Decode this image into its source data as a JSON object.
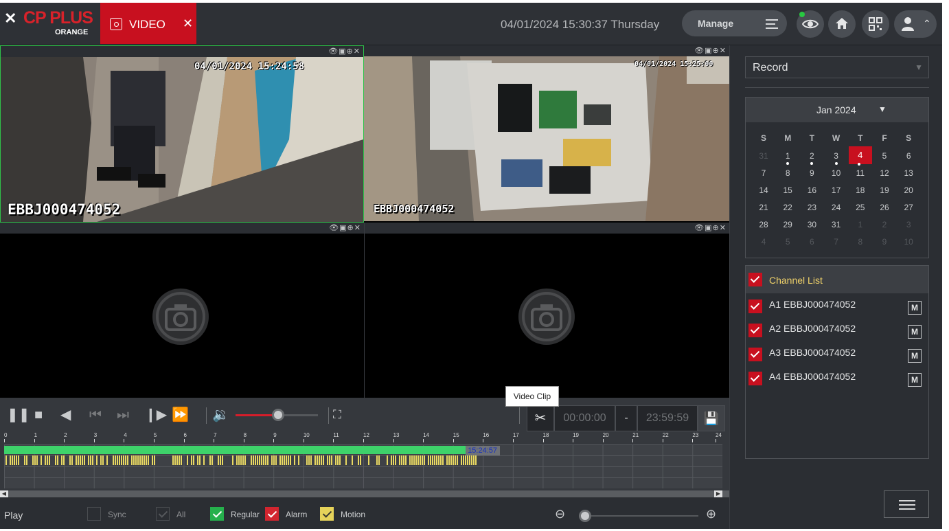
{
  "header": {
    "logo_text": "CP PLUS",
    "logo_sub": "ORANGE",
    "tab_label": "VIDEO",
    "datetime": "04/01/2024 15:30:37 Thursday",
    "manage_label": "Manage"
  },
  "cameras": [
    {
      "timestamp": "04/01/2024 15:24:58",
      "name": "EBBJ000474052"
    },
    {
      "timestamp": "04/01/2024 15:25:00",
      "name": "EBBJ000474052"
    }
  ],
  "controls": {
    "volume_level": 0.52,
    "clip_tooltip": "Video Clip",
    "clip_start": "00:00:00",
    "clip_dash": "-",
    "clip_end": "23:59:59"
  },
  "timeline": {
    "hours": [
      "0",
      "1",
      "2",
      "3",
      "4",
      "5",
      "6",
      "7",
      "8",
      "9",
      "10",
      "11",
      "12",
      "13",
      "14",
      "15",
      "16",
      "17",
      "18",
      "19",
      "20",
      "21",
      "22",
      "23",
      "24"
    ],
    "recording_end_hour": 15.75,
    "current_time": "15:24:57",
    "current_hour": 15.41
  },
  "bottom": {
    "play_label": "Play",
    "sync_label": "Sync",
    "all_label": "All",
    "regular_label": "Regular",
    "alarm_label": "Alarm",
    "motion_label": "Motion",
    "zoom_level": 0
  },
  "right_panel": {
    "record_type": "Record",
    "month_label": "Jan 2024",
    "weekdays": [
      "S",
      "M",
      "T",
      "W",
      "T",
      "F",
      "S"
    ],
    "days": [
      [
        "31",
        "1",
        "2",
        "3",
        "4",
        "5",
        "6"
      ],
      [
        "7",
        "8",
        "9",
        "10",
        "11",
        "12",
        "13"
      ],
      [
        "14",
        "15",
        "16",
        "17",
        "18",
        "19",
        "20"
      ],
      [
        "21",
        "22",
        "23",
        "24",
        "25",
        "26",
        "27"
      ],
      [
        "28",
        "29",
        "30",
        "31",
        "1",
        "2",
        "3"
      ],
      [
        "4",
        "5",
        "6",
        "7",
        "8",
        "9",
        "10"
      ]
    ],
    "selected_day": "4",
    "days_with_records": [
      "1",
      "2",
      "3",
      "4"
    ],
    "channel_list_title": "Channel List",
    "channels": [
      {
        "label": "A1 EBBJ000474052",
        "mode": "M"
      },
      {
        "label": "A2 EBBJ000474052",
        "mode": "M"
      },
      {
        "label": "A3 EBBJ000474052",
        "mode": "M"
      },
      {
        "label": "A4 EBBJ000474052",
        "mode": "M"
      }
    ]
  },
  "colors": {
    "brand_red": "#c8101f",
    "regular_green": "#3ed26a",
    "motion_yellow": "#e8d862",
    "alarm_red": "#d2252f"
  }
}
